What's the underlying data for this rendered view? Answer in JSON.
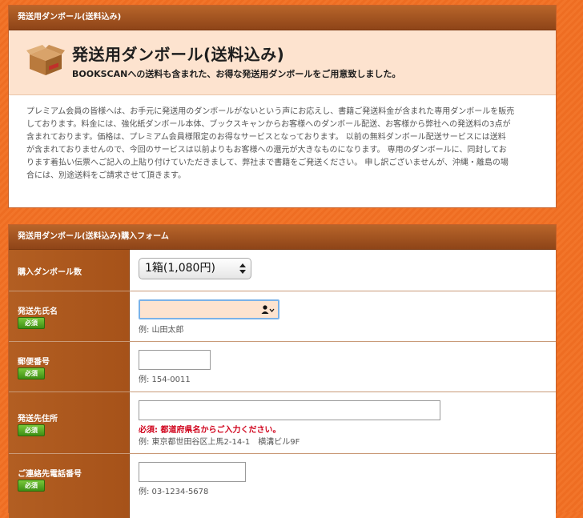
{
  "info": {
    "header": "発送用ダンボール(送料込み)",
    "title": "発送用ダンボール(送料込み)",
    "subtitle": "BOOKSCANへの送料も含まれた、お得な発送用ダンボールをご用意致しました。",
    "description_lines": [
      "プレミアム会員の皆様へは、お手元に発送用のダンボールがないという声にお応えし、書籍ご発送料金が含まれた専用ダンボールを販売",
      "しております。料金には、強化紙ダンボール本体、ブックスキャンからお客様へのダンボール配送、お客様から弊社への発送料の3点が",
      "含まれております。価格は、プレミアム会員様限定のお得なサービスとなっております。 以前の無料ダンボール配送サービスには送料",
      "が含まれておりませんので、今回のサービスは以前よりもお客様への還元が大きなものになります。 専用のダンボールに、同封してお",
      "ります着払い伝票へご記入の上貼り付けていただきまして、弊社まで書籍をご発送ください。 申し訳ございませんが、沖縄・離島の場",
      "合には、別途送料をご請求させて頂きます。"
    ]
  },
  "form": {
    "header": "発送用ダンボール(送料込み)購入フォーム",
    "required_badge": "必須",
    "quantity": {
      "label": "購入ダンボール数",
      "selected": "1箱(1,080円)"
    },
    "name": {
      "label": "発送先氏名",
      "value": "",
      "example": "例: 山田太郎"
    },
    "postal": {
      "label": "郵便番号",
      "value": "",
      "example": "例: 154-0011"
    },
    "address": {
      "label": "発送先住所",
      "value": "",
      "error": "必須: 都道府県名からご入力ください。",
      "example": "例: 東京都世田谷区上馬2-14-1　横溝ビル9F"
    },
    "phone": {
      "label": "ご連絡先電話番号",
      "value": "",
      "example": "例: 03-1234-5678"
    }
  },
  "colors": {
    "background": "#f2752a",
    "header_brown": "#9a4c1c",
    "hero_bg": "#fde3cf",
    "required_green": "#4fa21e",
    "error_red": "#d0021b",
    "active_input_bg": "#fde3cf"
  }
}
